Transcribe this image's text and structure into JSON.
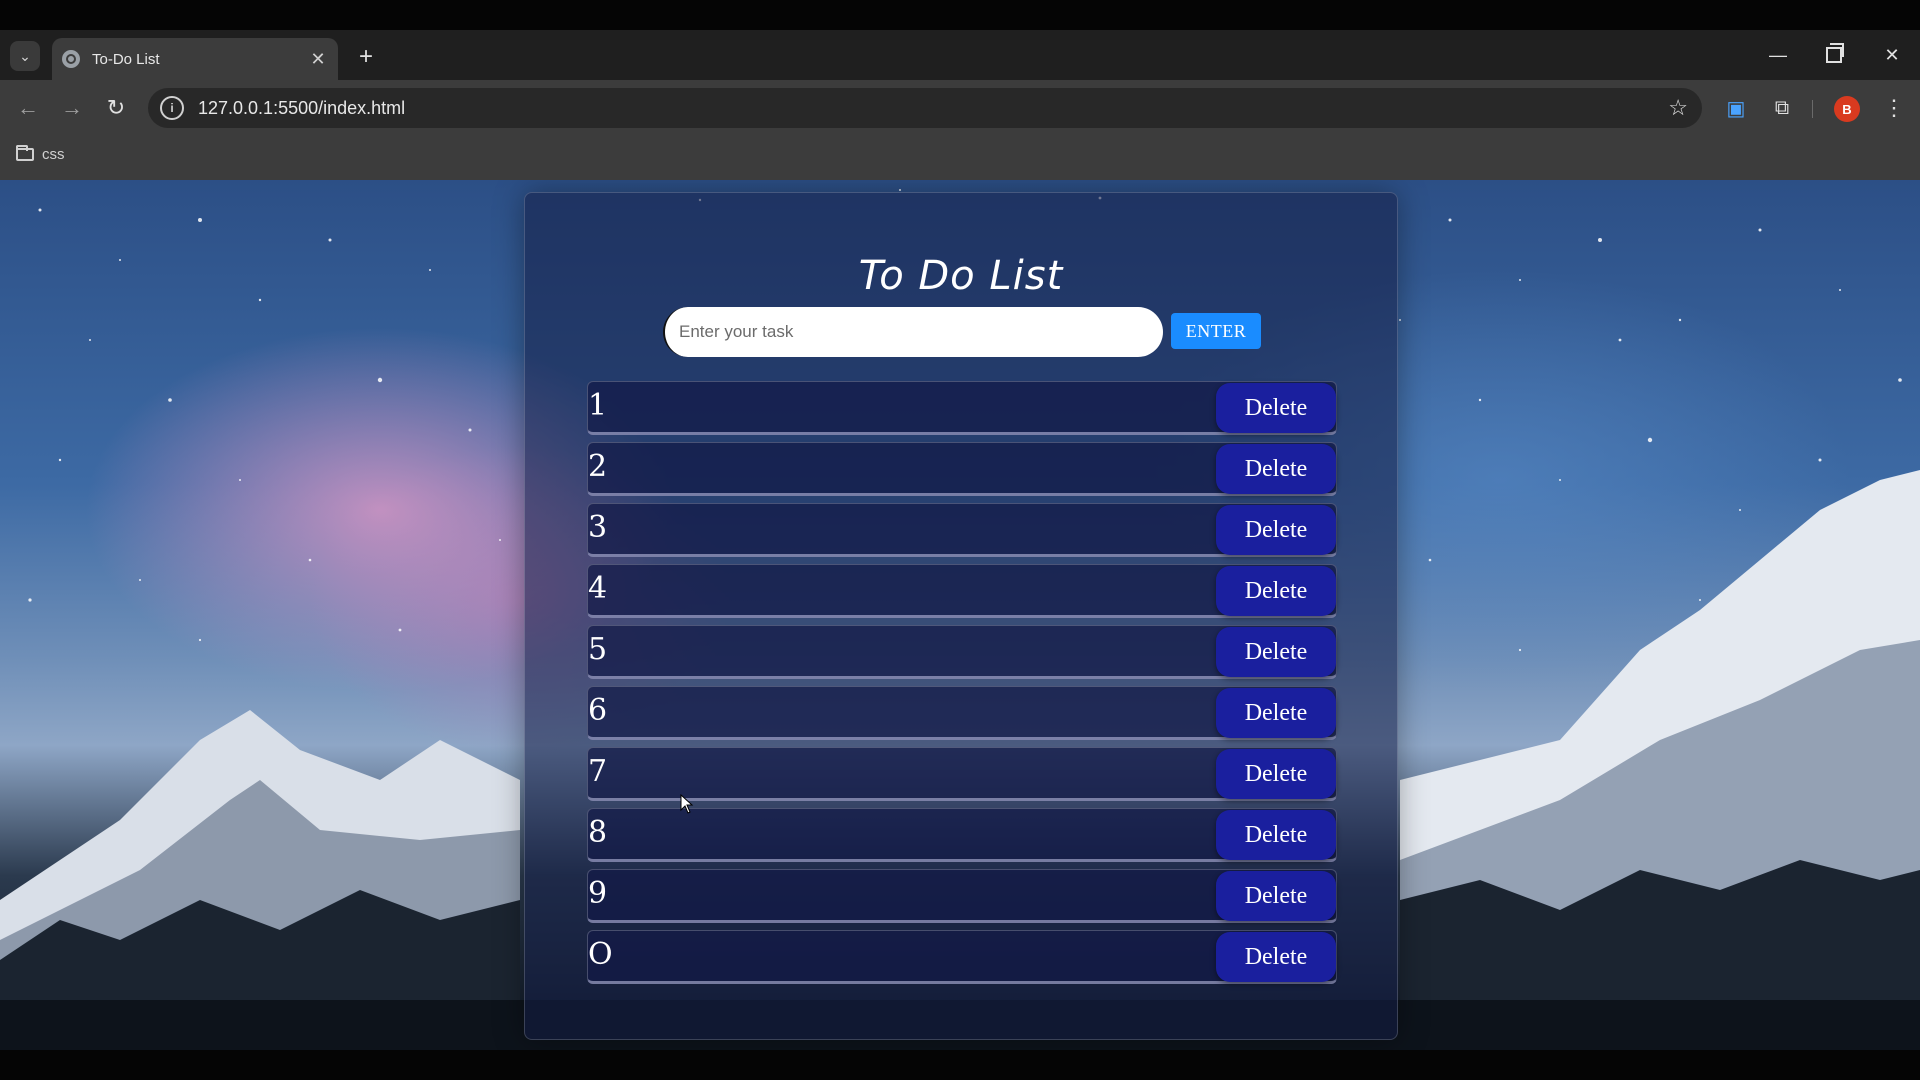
{
  "browser": {
    "tab_title": "To-Do List",
    "tab_close": "✕",
    "new_tab": "+",
    "url": "127.0.0.1:5500/index.html",
    "bookmark_label": "css",
    "profile_initial": "B",
    "window": {
      "minimize": "—",
      "close": "✕"
    },
    "nav": {
      "back": "←",
      "forward": "→",
      "reload": "↻"
    },
    "menu_dots": "⋮",
    "star": "☆",
    "puzzle": "⧉",
    "screen_icon": "▣",
    "dropdown": "⌄"
  },
  "app": {
    "title": "To Do List",
    "input_placeholder": "Enter your task",
    "enter_label": "ENTER",
    "delete_label": "Delete",
    "tasks": [
      {
        "text": "1"
      },
      {
        "text": "2"
      },
      {
        "text": "3"
      },
      {
        "text": "4"
      },
      {
        "text": "5"
      },
      {
        "text": "6"
      },
      {
        "text": "7"
      },
      {
        "text": "8"
      },
      {
        "text": "9"
      },
      {
        "text": "O"
      }
    ]
  },
  "colors": {
    "accent_blue": "#1a8cff",
    "delete_bg": "#1a1f9e",
    "profile_bg": "#d93a1f"
  }
}
